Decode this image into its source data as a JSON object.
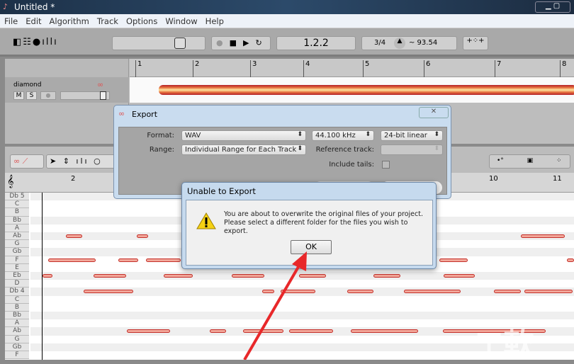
{
  "window": {
    "title": "Untitled *"
  },
  "menu": [
    "File",
    "Edit",
    "Algorithm",
    "Track",
    "Options",
    "Window",
    "Help"
  ],
  "transport": {
    "position": "1.2.2",
    "time_signature": "3/4",
    "tempo": "~ 93.54"
  },
  "ruler_top": [
    "1",
    "2",
    "3",
    "4",
    "5",
    "6",
    "7",
    "8"
  ],
  "track": {
    "name": "diamond",
    "mute": "M",
    "solo": "S"
  },
  "ruler_editor": [
    "2",
    "10",
    "11"
  ],
  "note_labels": [
    "Db 5",
    "C",
    "B",
    "Bb",
    "A",
    "Ab",
    "G",
    "Gb",
    "F",
    "E",
    "Eb",
    "D",
    "Db 4",
    "C",
    "B",
    "Bb",
    "A",
    "Ab",
    "G",
    "Gb",
    "F"
  ],
  "export_dialog": {
    "title": "Export",
    "format_label": "Format:",
    "format": "WAV",
    "sample_rate": "44.100 kHz",
    "bit_depth": "24-bit linear",
    "range_label": "Range:",
    "range": "Individual Range for Each Track",
    "reference_label": "Reference track:",
    "reference": "",
    "tails_label": "Include tails:",
    "include_tails": false
  },
  "alert": {
    "title": "Unable to Export",
    "line1": "You are about to overwrite the original files of your project.",
    "line2": "Please select a different folder for the files you wish to export.",
    "ok": "OK"
  },
  "colors": {
    "note_fill": "#f2a79a",
    "note_border": "#c4302a",
    "arrow": "#e8282a"
  }
}
